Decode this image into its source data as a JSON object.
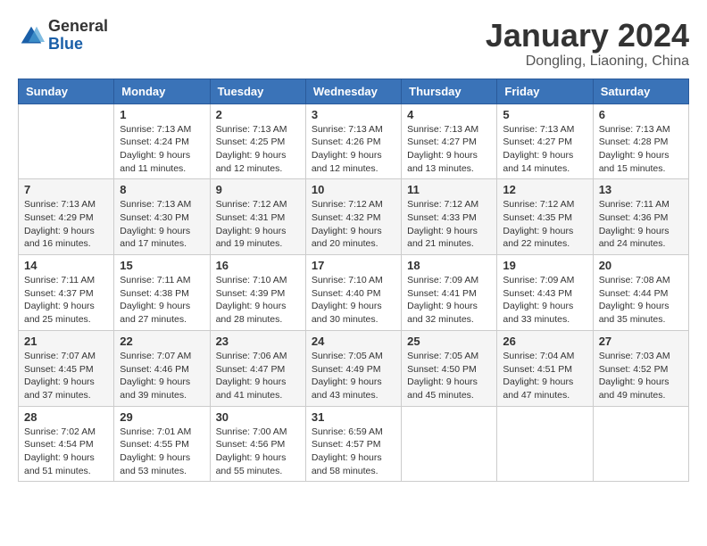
{
  "header": {
    "logo": {
      "line1": "General",
      "line2": "Blue"
    },
    "month": "January 2024",
    "location": "Dongling, Liaoning, China"
  },
  "weekdays": [
    "Sunday",
    "Monday",
    "Tuesday",
    "Wednesday",
    "Thursday",
    "Friday",
    "Saturday"
  ],
  "weeks": [
    [
      {
        "day": "",
        "info": ""
      },
      {
        "day": "1",
        "info": "Sunrise: 7:13 AM\nSunset: 4:24 PM\nDaylight: 9 hours\nand 11 minutes."
      },
      {
        "day": "2",
        "info": "Sunrise: 7:13 AM\nSunset: 4:25 PM\nDaylight: 9 hours\nand 12 minutes."
      },
      {
        "day": "3",
        "info": "Sunrise: 7:13 AM\nSunset: 4:26 PM\nDaylight: 9 hours\nand 12 minutes."
      },
      {
        "day": "4",
        "info": "Sunrise: 7:13 AM\nSunset: 4:27 PM\nDaylight: 9 hours\nand 13 minutes."
      },
      {
        "day": "5",
        "info": "Sunrise: 7:13 AM\nSunset: 4:27 PM\nDaylight: 9 hours\nand 14 minutes."
      },
      {
        "day": "6",
        "info": "Sunrise: 7:13 AM\nSunset: 4:28 PM\nDaylight: 9 hours\nand 15 minutes."
      }
    ],
    [
      {
        "day": "7",
        "info": "Sunrise: 7:13 AM\nSunset: 4:29 PM\nDaylight: 9 hours\nand 16 minutes."
      },
      {
        "day": "8",
        "info": "Sunrise: 7:13 AM\nSunset: 4:30 PM\nDaylight: 9 hours\nand 17 minutes."
      },
      {
        "day": "9",
        "info": "Sunrise: 7:12 AM\nSunset: 4:31 PM\nDaylight: 9 hours\nand 19 minutes."
      },
      {
        "day": "10",
        "info": "Sunrise: 7:12 AM\nSunset: 4:32 PM\nDaylight: 9 hours\nand 20 minutes."
      },
      {
        "day": "11",
        "info": "Sunrise: 7:12 AM\nSunset: 4:33 PM\nDaylight: 9 hours\nand 21 minutes."
      },
      {
        "day": "12",
        "info": "Sunrise: 7:12 AM\nSunset: 4:35 PM\nDaylight: 9 hours\nand 22 minutes."
      },
      {
        "day": "13",
        "info": "Sunrise: 7:11 AM\nSunset: 4:36 PM\nDaylight: 9 hours\nand 24 minutes."
      }
    ],
    [
      {
        "day": "14",
        "info": "Sunrise: 7:11 AM\nSunset: 4:37 PM\nDaylight: 9 hours\nand 25 minutes."
      },
      {
        "day": "15",
        "info": "Sunrise: 7:11 AM\nSunset: 4:38 PM\nDaylight: 9 hours\nand 27 minutes."
      },
      {
        "day": "16",
        "info": "Sunrise: 7:10 AM\nSunset: 4:39 PM\nDaylight: 9 hours\nand 28 minutes."
      },
      {
        "day": "17",
        "info": "Sunrise: 7:10 AM\nSunset: 4:40 PM\nDaylight: 9 hours\nand 30 minutes."
      },
      {
        "day": "18",
        "info": "Sunrise: 7:09 AM\nSunset: 4:41 PM\nDaylight: 9 hours\nand 32 minutes."
      },
      {
        "day": "19",
        "info": "Sunrise: 7:09 AM\nSunset: 4:43 PM\nDaylight: 9 hours\nand 33 minutes."
      },
      {
        "day": "20",
        "info": "Sunrise: 7:08 AM\nSunset: 4:44 PM\nDaylight: 9 hours\nand 35 minutes."
      }
    ],
    [
      {
        "day": "21",
        "info": "Sunrise: 7:07 AM\nSunset: 4:45 PM\nDaylight: 9 hours\nand 37 minutes."
      },
      {
        "day": "22",
        "info": "Sunrise: 7:07 AM\nSunset: 4:46 PM\nDaylight: 9 hours\nand 39 minutes."
      },
      {
        "day": "23",
        "info": "Sunrise: 7:06 AM\nSunset: 4:47 PM\nDaylight: 9 hours\nand 41 minutes."
      },
      {
        "day": "24",
        "info": "Sunrise: 7:05 AM\nSunset: 4:49 PM\nDaylight: 9 hours\nand 43 minutes."
      },
      {
        "day": "25",
        "info": "Sunrise: 7:05 AM\nSunset: 4:50 PM\nDaylight: 9 hours\nand 45 minutes."
      },
      {
        "day": "26",
        "info": "Sunrise: 7:04 AM\nSunset: 4:51 PM\nDaylight: 9 hours\nand 47 minutes."
      },
      {
        "day": "27",
        "info": "Sunrise: 7:03 AM\nSunset: 4:52 PM\nDaylight: 9 hours\nand 49 minutes."
      }
    ],
    [
      {
        "day": "28",
        "info": "Sunrise: 7:02 AM\nSunset: 4:54 PM\nDaylight: 9 hours\nand 51 minutes."
      },
      {
        "day": "29",
        "info": "Sunrise: 7:01 AM\nSunset: 4:55 PM\nDaylight: 9 hours\nand 53 minutes."
      },
      {
        "day": "30",
        "info": "Sunrise: 7:00 AM\nSunset: 4:56 PM\nDaylight: 9 hours\nand 55 minutes."
      },
      {
        "day": "31",
        "info": "Sunrise: 6:59 AM\nSunset: 4:57 PM\nDaylight: 9 hours\nand 58 minutes."
      },
      {
        "day": "",
        "info": ""
      },
      {
        "day": "",
        "info": ""
      },
      {
        "day": "",
        "info": ""
      }
    ]
  ]
}
